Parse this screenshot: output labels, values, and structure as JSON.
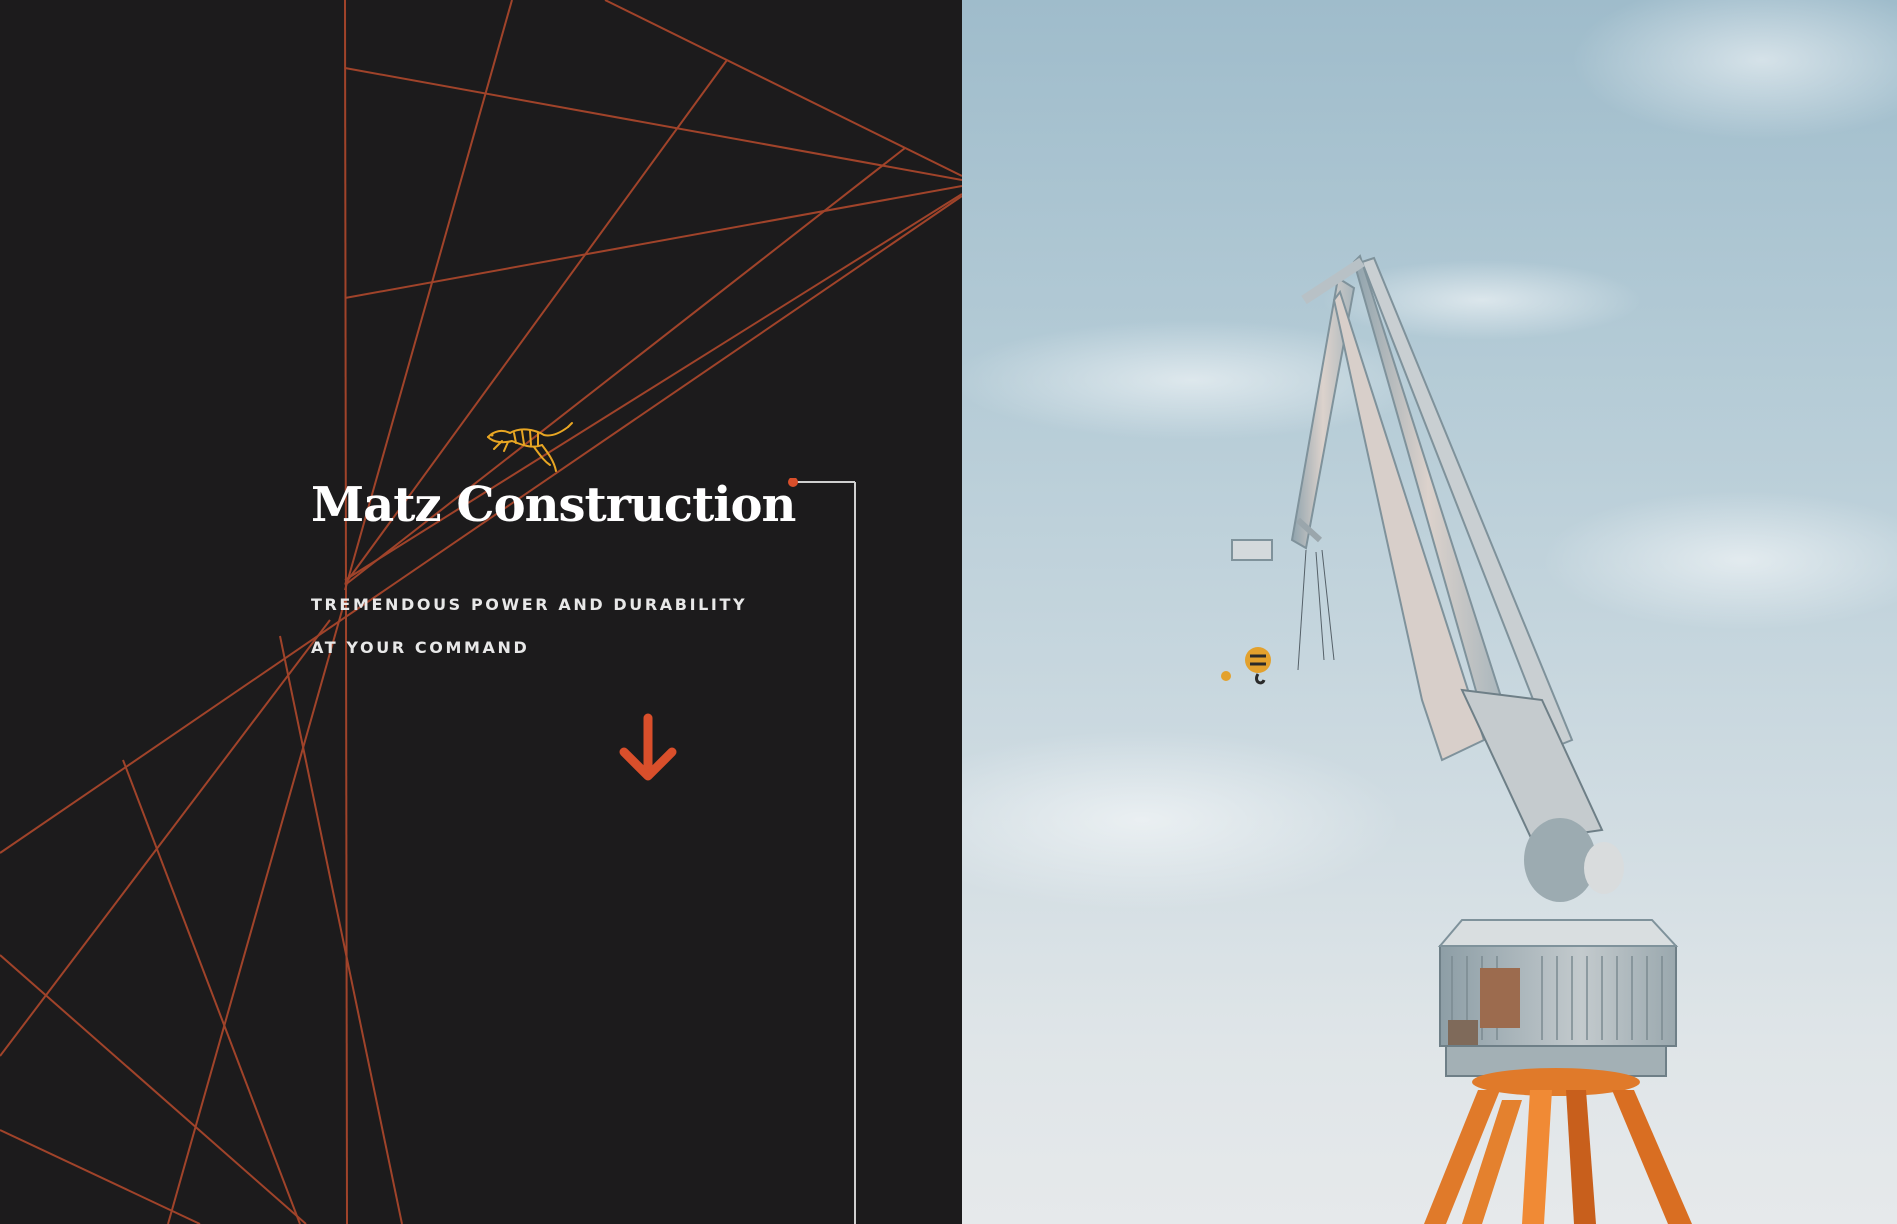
{
  "brand": {
    "name": "Matz Construction",
    "logo_icon": "leaping-tiger-icon"
  },
  "hero": {
    "tagline_line1": "TREMENDOUS POWER AND DURABILITY",
    "tagline_line2": "AT YOUR COMMAND",
    "scroll_icon": "arrow-down-icon"
  },
  "photo": {
    "subject": "harbor crane against sky"
  },
  "colors": {
    "background_dark": "#1c1b1c",
    "accent_orange": "#d94f2b",
    "line_rust": "#a8462b",
    "logo_gold": "#e8a623",
    "text_white": "#ffffff"
  }
}
